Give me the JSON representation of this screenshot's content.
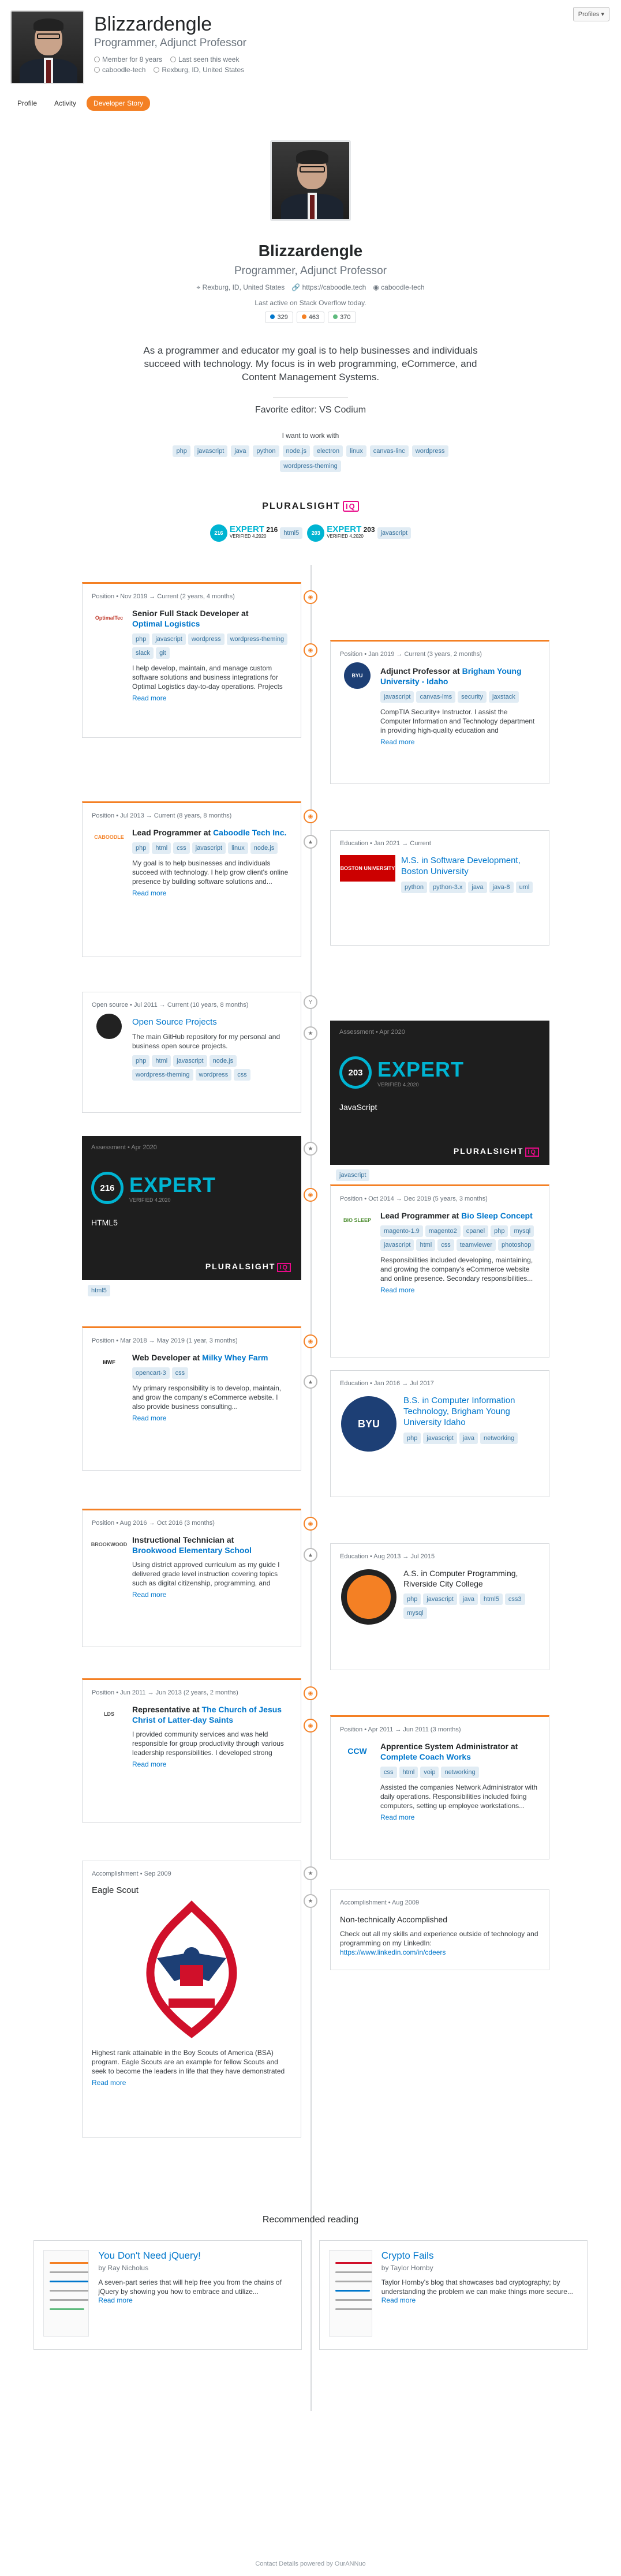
{
  "user": {
    "name": "Blizzardengle",
    "role": "Programmer, Adjunct Professor",
    "member_for": "Member for 8 years",
    "last_seen": "Last seen this week",
    "website": "caboodle.tech",
    "location": "Rexburg, ID, United States",
    "github": "caboodle-tech",
    "last_active": "Last active on Stack Overflow today."
  },
  "profiles_button": "Profiles ▾",
  "tabs": [
    "Profile",
    "Activity",
    "Developer Story"
  ],
  "stats": [
    "329",
    "463",
    "370"
  ],
  "hero_meta": {
    "location": "Rexburg, ID, United States",
    "website": "https://caboodle.tech",
    "github": "caboodle-tech"
  },
  "bio": "As a programmer and educator my goal is to help businesses and individuals succeed with technology. My focus is in web programming, eCommerce, and Content Management Systems.",
  "favorite_editor": "Favorite editor: VS Codium",
  "want_title": "I want to work with",
  "want_tags": [
    "php",
    "javascript",
    "java",
    "python",
    "node.js",
    "electron",
    "linux",
    "canvas-linc",
    "wordpress",
    "wordpress-theming"
  ],
  "pluralsight": {
    "brand": "PLURALSIGHT",
    "iq": "IQ",
    "exp1": {
      "score": "216",
      "label": "EXPERT",
      "lang": "html5",
      "verified": "VERIFIED 4.2020"
    },
    "exp2": {
      "score": "203",
      "label": "EXPERT",
      "lang": "javascript",
      "verified": "VERIFIED 4.2020"
    }
  },
  "timeline": {
    "c1": {
      "when": "Position • Nov 2019 → Current (2 years, 4 months)",
      "logo": "OptimalTec",
      "title": "Senior Full Stack Developer at",
      "org": "Optimal Logistics",
      "tags": [
        "php",
        "javascript",
        "wordpress",
        "wordpress-theming",
        "slack",
        "git"
      ],
      "desc": "I help develop, maintain, and manage custom software solutions and business integrations for Optimal Logistics day-to-day operations. Projects include...",
      "more": "Read more"
    },
    "c2": {
      "when": "Position • Jan 2019 → Current (3 years, 2 months)",
      "logo": "BYU",
      "title": "Adjunct Professor at",
      "org": "Brigham Young University - Idaho",
      "tags": [
        "javascript",
        "canvas-lms",
        "security",
        "jaxstack"
      ],
      "desc": "CompTIA Security+ Instructor. I assist the Computer Information and Technology department in providing high-quality education and experience...",
      "more": "Read more"
    },
    "c3": {
      "when": "Position • Jul 2013 → Current (8 years, 8 months)",
      "logo": "CABOODLE",
      "title": "Lead Programmer at",
      "org": "Caboodle Tech Inc.",
      "tags": [
        "php",
        "html",
        "css",
        "javascript",
        "linux",
        "node.js"
      ],
      "desc": "My goal is to help businesses and individuals succeed with technology. I help grow client's online presence by building software solutions and...",
      "more": "Read more"
    },
    "c4": {
      "when": "Education • Jan 2021 → Current",
      "logo": "BOSTON UNIVERSITY",
      "title": "M.S. in Software Development, Boston University",
      "tags": [
        "python",
        "python-3.x",
        "java",
        "java-8",
        "uml"
      ]
    },
    "c5": {
      "when": "Open source • Jul 2011 → Current (10 years, 8 months)",
      "title": "Open Source Projects",
      "desc": "The main GitHub repository for my personal and business open source projects.",
      "tags": [
        "php",
        "html",
        "javascript",
        "node.js",
        "wordpress-theming",
        "wordpress",
        "css"
      ]
    },
    "c6": {
      "when": "Assessment • Apr 2020",
      "score": "203",
      "label": "EXPERT",
      "verified": "VERIFIED 4.2020",
      "lang": "JavaScript",
      "tag": "javascript"
    },
    "c7": {
      "when": "Assessment • Apr 2020",
      "score": "216",
      "label": "EXPERT",
      "verified": "VERIFIED 4.2020",
      "lang": "HTML5",
      "tag": "html5"
    },
    "c8": {
      "when": "Position • Oct 2014 → Dec 2019 (5 years, 3 months)",
      "logo": "BIO SLEEP",
      "title": "Lead Programmer at",
      "org": "Bio Sleep Concept",
      "tags": [
        "magento-1.9",
        "magento2",
        "cpanel",
        "php",
        "mysql",
        "javascript",
        "html",
        "css",
        "teamviewer",
        "photoshop"
      ],
      "desc": "Responsibilities included developing, maintaining, and growing the company's eCommerce website and online presence. Secondary responsibilities...",
      "more": "Read more"
    },
    "c9": {
      "when": "Position • Mar 2018 → May 2019 (1 year, 3 months)",
      "logo": "MWF",
      "title": "Web Developer at",
      "org": "Milky Whey Farm",
      "tags": [
        "opencart-3",
        "css"
      ],
      "desc": "My primary responsibility is to develop, maintain, and grow the company's eCommerce website. I also provide business consulting...",
      "more": "Read more"
    },
    "c10": {
      "when": "Education • Jan 2016 → Jul 2017",
      "logo": "BYU",
      "title": "B.S. in Computer Information Technology, Brigham Young University Idaho",
      "tags": [
        "php",
        "javascript",
        "java",
        "networking"
      ]
    },
    "c11": {
      "when": "Position • Aug 2016 → Oct 2016 (3 months)",
      "logo": "BROOKWOOD",
      "title": "Instructional Technician at",
      "org": "Brookwood Elementary School",
      "desc": "Using district approved curriculum as my guide I delivered grade level instruction covering topics such as digital citizenship, programming, and Microsoft...",
      "more": "Read more"
    },
    "c12": {
      "when": "Education • Aug 2013 → Jul 2015",
      "title": "A.S. in Computer Programming, Riverside City College",
      "tags": [
        "php",
        "javascript",
        "java",
        "html5",
        "css3",
        "mysql"
      ]
    },
    "c13": {
      "when": "Position • Jun 2011 → Jun 2013 (2 years, 2 months)",
      "logo": "LDS",
      "title": "Representative at",
      "org": "The Church of Jesus Christ of Latter-day Saints",
      "desc": "I provided community services and was held responsible for group productivity through various leadership responsibilities. I developed strong people...",
      "more": "Read more"
    },
    "c14": {
      "when": "Position • Apr 2011 → Jun 2011 (3 months)",
      "logo": "CCW",
      "title": "Apprentice System Administrator at",
      "org": "Complete Coach Works",
      "tags": [
        "css",
        "html",
        "voip",
        "networking"
      ],
      "desc": "Assisted the companies Network Administrator with daily operations. Responsibilities included fixing computers, setting up employee workstations...",
      "more": "Read more"
    },
    "c15": {
      "when": "Accomplishment • Sep 2009",
      "title": "Eagle Scout",
      "desc": "Highest rank attainable in the Boy Scouts of America (BSA) program. Eagle Scouts are an example for fellow Scouts and seek to become the leaders in life that they have demonstrated themselves...",
      "more": "Read more"
    },
    "c16": {
      "when": "Accomplishment • Aug 2009",
      "title": "Non-technically Accomplished",
      "desc": "Check out all my skills and experience outside of technology and programming on my LinkedIn:",
      "link": "https://www.linkedin.com/in/cdeers"
    }
  },
  "recommended": {
    "title": "Recommended reading",
    "items": [
      {
        "title": "You Don't Need jQuery!",
        "by": "by Ray Nicholus",
        "desc": "A seven-part series that will help free you from the chains of jQuery by showing you how to embrace and utilize...",
        "more": "Read more"
      },
      {
        "title": "Crypto Fails",
        "by": "by Taylor Hornby",
        "desc": "Taylor Hornby's blog that showcases bad cryptography; by understanding the problem we can make things more secure...",
        "more": "Read more"
      }
    ]
  },
  "footer": "Contact Details powered by OurANNuo"
}
